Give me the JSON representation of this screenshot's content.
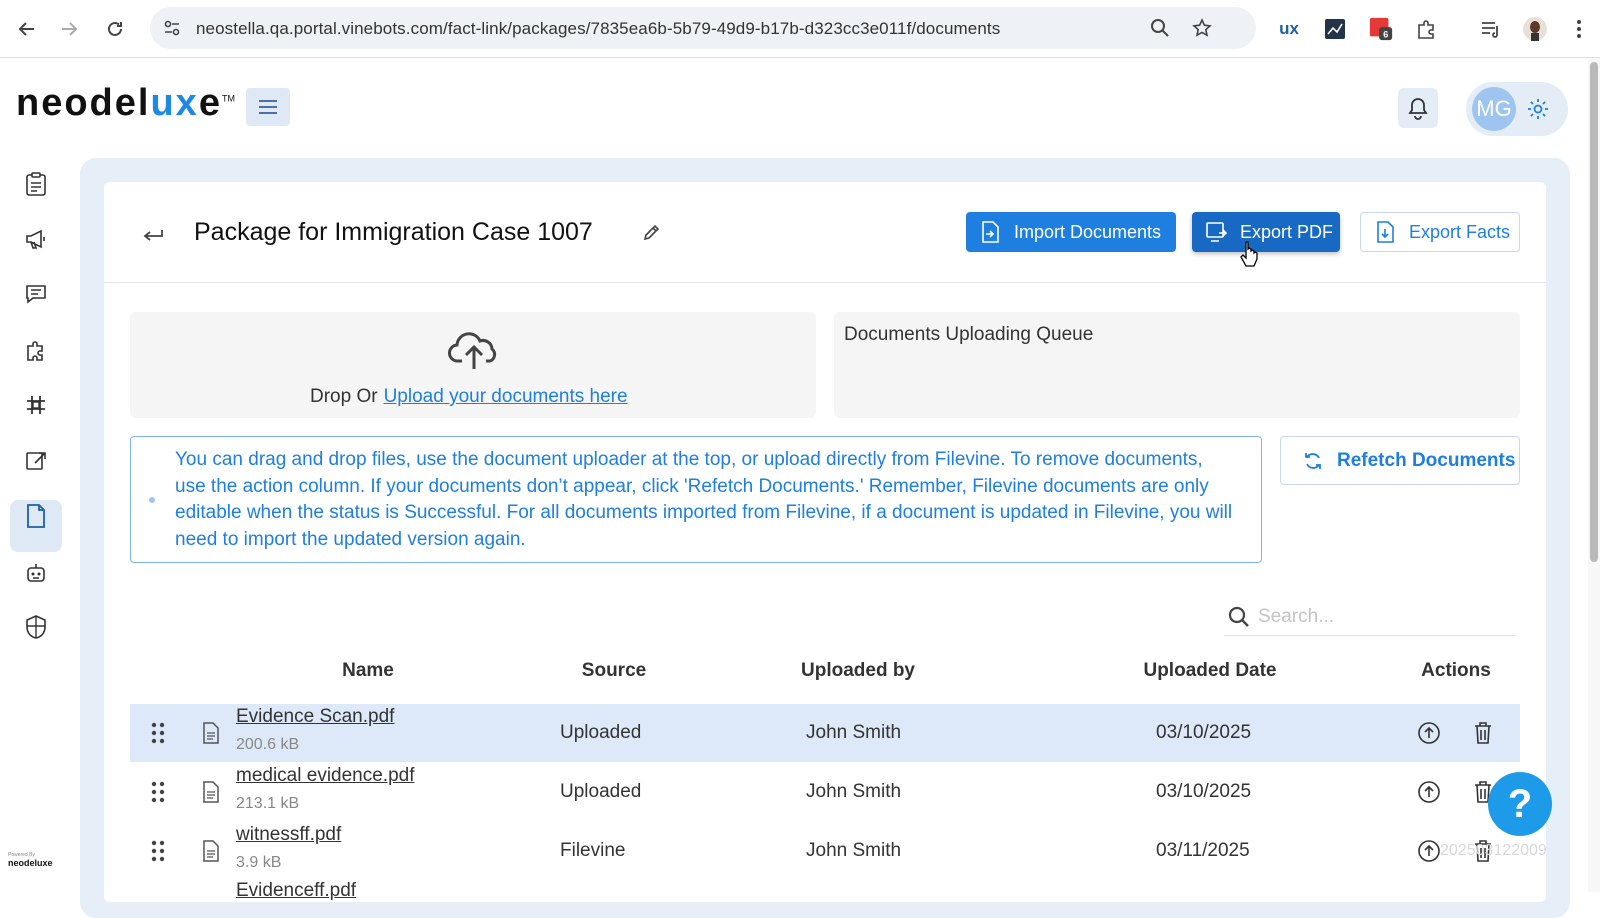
{
  "browser": {
    "url": "neostella.qa.portal.vinebots.com/fact-link/packages/7835ea6b-5b79-49d9-b17b-d323cc3e011f/documents",
    "ext_badge": "6",
    "ux_label": "ux"
  },
  "header": {
    "logo_main": "neodel",
    "logo_accent": "ux",
    "logo_end": "e",
    "logo_tm": "TM",
    "avatar_initials": "MG"
  },
  "sidebar": {
    "powered_by": "Powered By",
    "powered_brand": "neodeluxe",
    "items": [
      "clipboard",
      "megaphone",
      "chat",
      "puzzle",
      "grid",
      "export",
      "document",
      "robot",
      "shield"
    ]
  },
  "page": {
    "title": "Package for Immigration Case 1007",
    "buttons": {
      "import": "Import Documents",
      "export_pdf": "Export PDF",
      "export_facts": "Export Facts",
      "refetch": "Refetch Documents"
    }
  },
  "upload": {
    "drop_prefix": "Drop Or",
    "drop_link": "Upload your documents here",
    "queue_title": "Documents Uploading Queue"
  },
  "info": {
    "text": "You can drag and drop files, use the document uploader at the top, or upload directly from Filevine. To remove documents, use the action column. If your documents don’t appear, click 'Refetch Documents.' Remember, Filevine documents are only editable when the status is Successful. For all documents imported from Filevine, if a document is updated in Filevine, you will need to import the updated version again."
  },
  "search": {
    "placeholder": "Search..."
  },
  "table": {
    "columns": [
      "Name",
      "Source",
      "Uploaded by",
      "Uploaded Date",
      "Actions"
    ],
    "rows": [
      {
        "name": "Evidence Scan.pdf",
        "size": "200.6 kB",
        "source": "Uploaded",
        "uploaded_by": "John Smith",
        "date": "03/10/2025"
      },
      {
        "name": "medical evidence.pdf",
        "size": "213.1 kB",
        "source": "Uploaded",
        "uploaded_by": "John Smith",
        "date": "03/10/2025"
      },
      {
        "name": "witnessff.pdf",
        "size": "3.9 kB",
        "source": "Filevine",
        "uploaded_by": "John Smith",
        "date": "03/11/2025"
      }
    ],
    "next_row_name": "Evidenceff.pdf"
  },
  "help": {
    "label": "?"
  },
  "build_id": "202503122009",
  "colors": {
    "accent": "#1e7fe0",
    "selected_row": "#dde9f8",
    "help": "#1e9be8"
  }
}
